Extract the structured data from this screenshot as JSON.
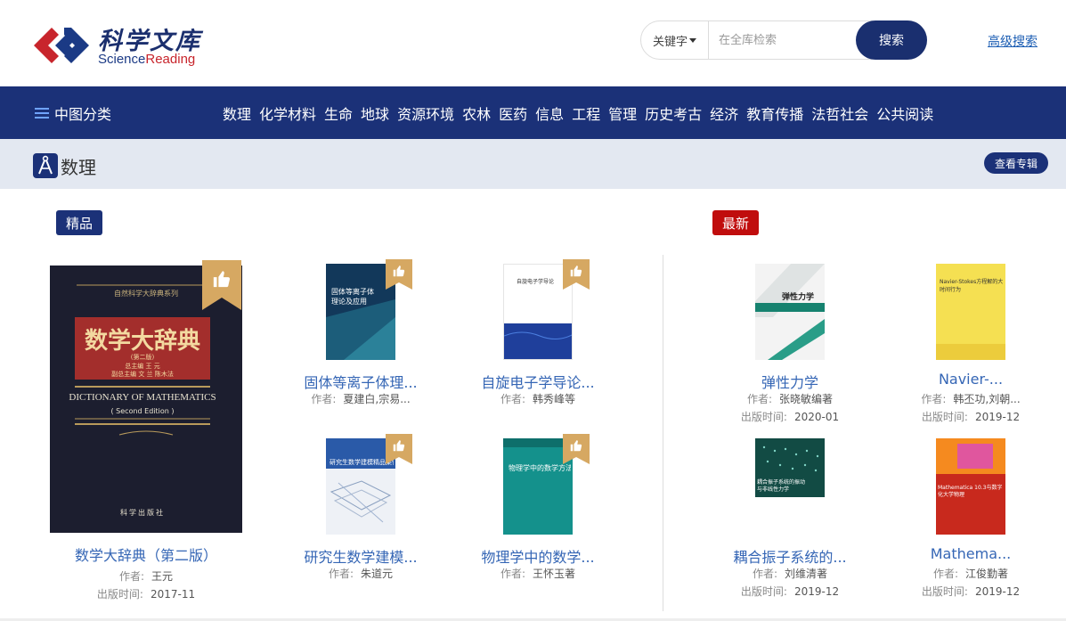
{
  "logo": {
    "cn": "科学文库",
    "en_science": "Science",
    "en_reading": "Reading"
  },
  "search": {
    "type_label": "关键字",
    "placeholder": "在全库检索",
    "button": "搜索",
    "advanced": "高级搜索"
  },
  "nav": {
    "category_label": "中图分类",
    "items": [
      "数理",
      "化学材料",
      "生命",
      "地球",
      "资源环境",
      "农林",
      "医药",
      "信息",
      "工程",
      "管理",
      "历史考古",
      "经济",
      "教育传播",
      "法哲社会",
      "公共阅读"
    ]
  },
  "section": {
    "title": "数理",
    "view_special": "查看专辑"
  },
  "featured_label": "精品",
  "latest_label": "最新",
  "meta_labels": {
    "author": "作者:",
    "pub_date": "出版时间:"
  },
  "featured": {
    "main": {
      "title": "数学大辞典（第二版）",
      "author": "王元",
      "date": "2017-11",
      "cover": {
        "series": "自然科学大辞典系列",
        "cn_title": "数学大辞典",
        "edition_cn": "(第二版)",
        "editor_line1": "总主编  王  元",
        "editor_line2": "副总主编  文  兰  陈木法",
        "en_title": "DICTIONARY OF MATHEMATICS",
        "en_edition": "( Second Edition )",
        "publisher": "科学出版社"
      }
    },
    "small": [
      {
        "title": "固体等离子体理...",
        "author": "夏建白,宗易...",
        "cover_text": "固体等离子体理论及应用"
      },
      {
        "title": "自旋电子学导论...",
        "author": "韩秀峰等",
        "cover_text": "自旋电子学导论"
      },
      {
        "title": "研究生数学建模...",
        "author": "朱道元",
        "cover_text": "研究生数学建模精品案例"
      },
      {
        "title": "物理学中的数学...",
        "author": "王怀玉著",
        "cover_text": "物理学中的数学方法"
      }
    ]
  },
  "latest": [
    {
      "title": "弹性力学",
      "author": "张晓敏编著",
      "date": "2020-01",
      "cover_text": "弹性力学"
    },
    {
      "title": "Navier-...",
      "author": "韩丕功,刘朝...",
      "date": "2019-12",
      "cover_text": "Navier-Stokes方程解的大时间行为"
    },
    {
      "title": "耦合振子系统的...",
      "author": "刘维清著",
      "date": "2019-12",
      "cover_text": "耦合振子系统的振动与非线性力学"
    },
    {
      "title": "Mathema...",
      "author": "江俊勤著",
      "date": "2019-12",
      "cover_text": "Mathematica 10.3与数字化大学物理"
    }
  ],
  "colors": {
    "primary": "#1b3178",
    "red": "#c00d0d",
    "ribbon": "#d6a862",
    "link": "#3566b5"
  }
}
